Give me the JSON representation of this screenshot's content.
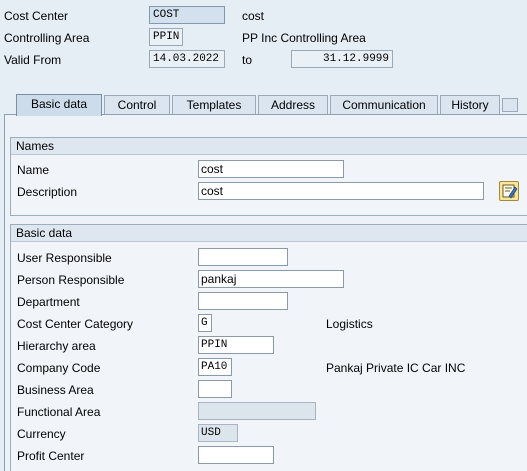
{
  "header": {
    "cost_center_label": "Cost Center",
    "cost_center_value": "COST",
    "cost_center_text": "cost",
    "controlling_area_label": "Controlling Area",
    "controlling_area_value": "PPIN",
    "controlling_area_text": "PP Inc Controlling Area",
    "valid_from_label": "Valid From",
    "valid_from_value": "14.03.2022",
    "to_label": "to",
    "valid_to_value": "31.12.9999"
  },
  "tabs": [
    {
      "label": "Basic data",
      "active": true
    },
    {
      "label": "Control"
    },
    {
      "label": "Templates"
    },
    {
      "label": "Address"
    },
    {
      "label": "Communication"
    },
    {
      "label": "History"
    }
  ],
  "names_group": {
    "title": "Names",
    "name_label": "Name",
    "name_value": "cost",
    "description_label": "Description",
    "description_value": "cost",
    "edit_icon": "edit-long-text-icon"
  },
  "basic_group": {
    "title": "Basic data",
    "fields": [
      {
        "label": "User Responsible",
        "value": ""
      },
      {
        "label": "Person Responsible",
        "value": "pankaj"
      },
      {
        "label": "Department",
        "value": ""
      },
      {
        "label": "Cost Center Category",
        "value": "G",
        "text": "Logistics"
      },
      {
        "label": "Hierarchy area",
        "value": "PPIN"
      },
      {
        "label": "Company Code",
        "value": "PA10",
        "text": "Pankaj Private IC Car INC"
      },
      {
        "label": "Business Area",
        "value": ""
      },
      {
        "label": "Functional Area",
        "value": ""
      },
      {
        "label": "Currency",
        "value": "USD"
      },
      {
        "label": "Profit Center",
        "value": ""
      }
    ]
  },
  "colors": {
    "background": "#e5edf5",
    "active_tab": "#ccdcea",
    "output_field": "#d3e1ef"
  }
}
